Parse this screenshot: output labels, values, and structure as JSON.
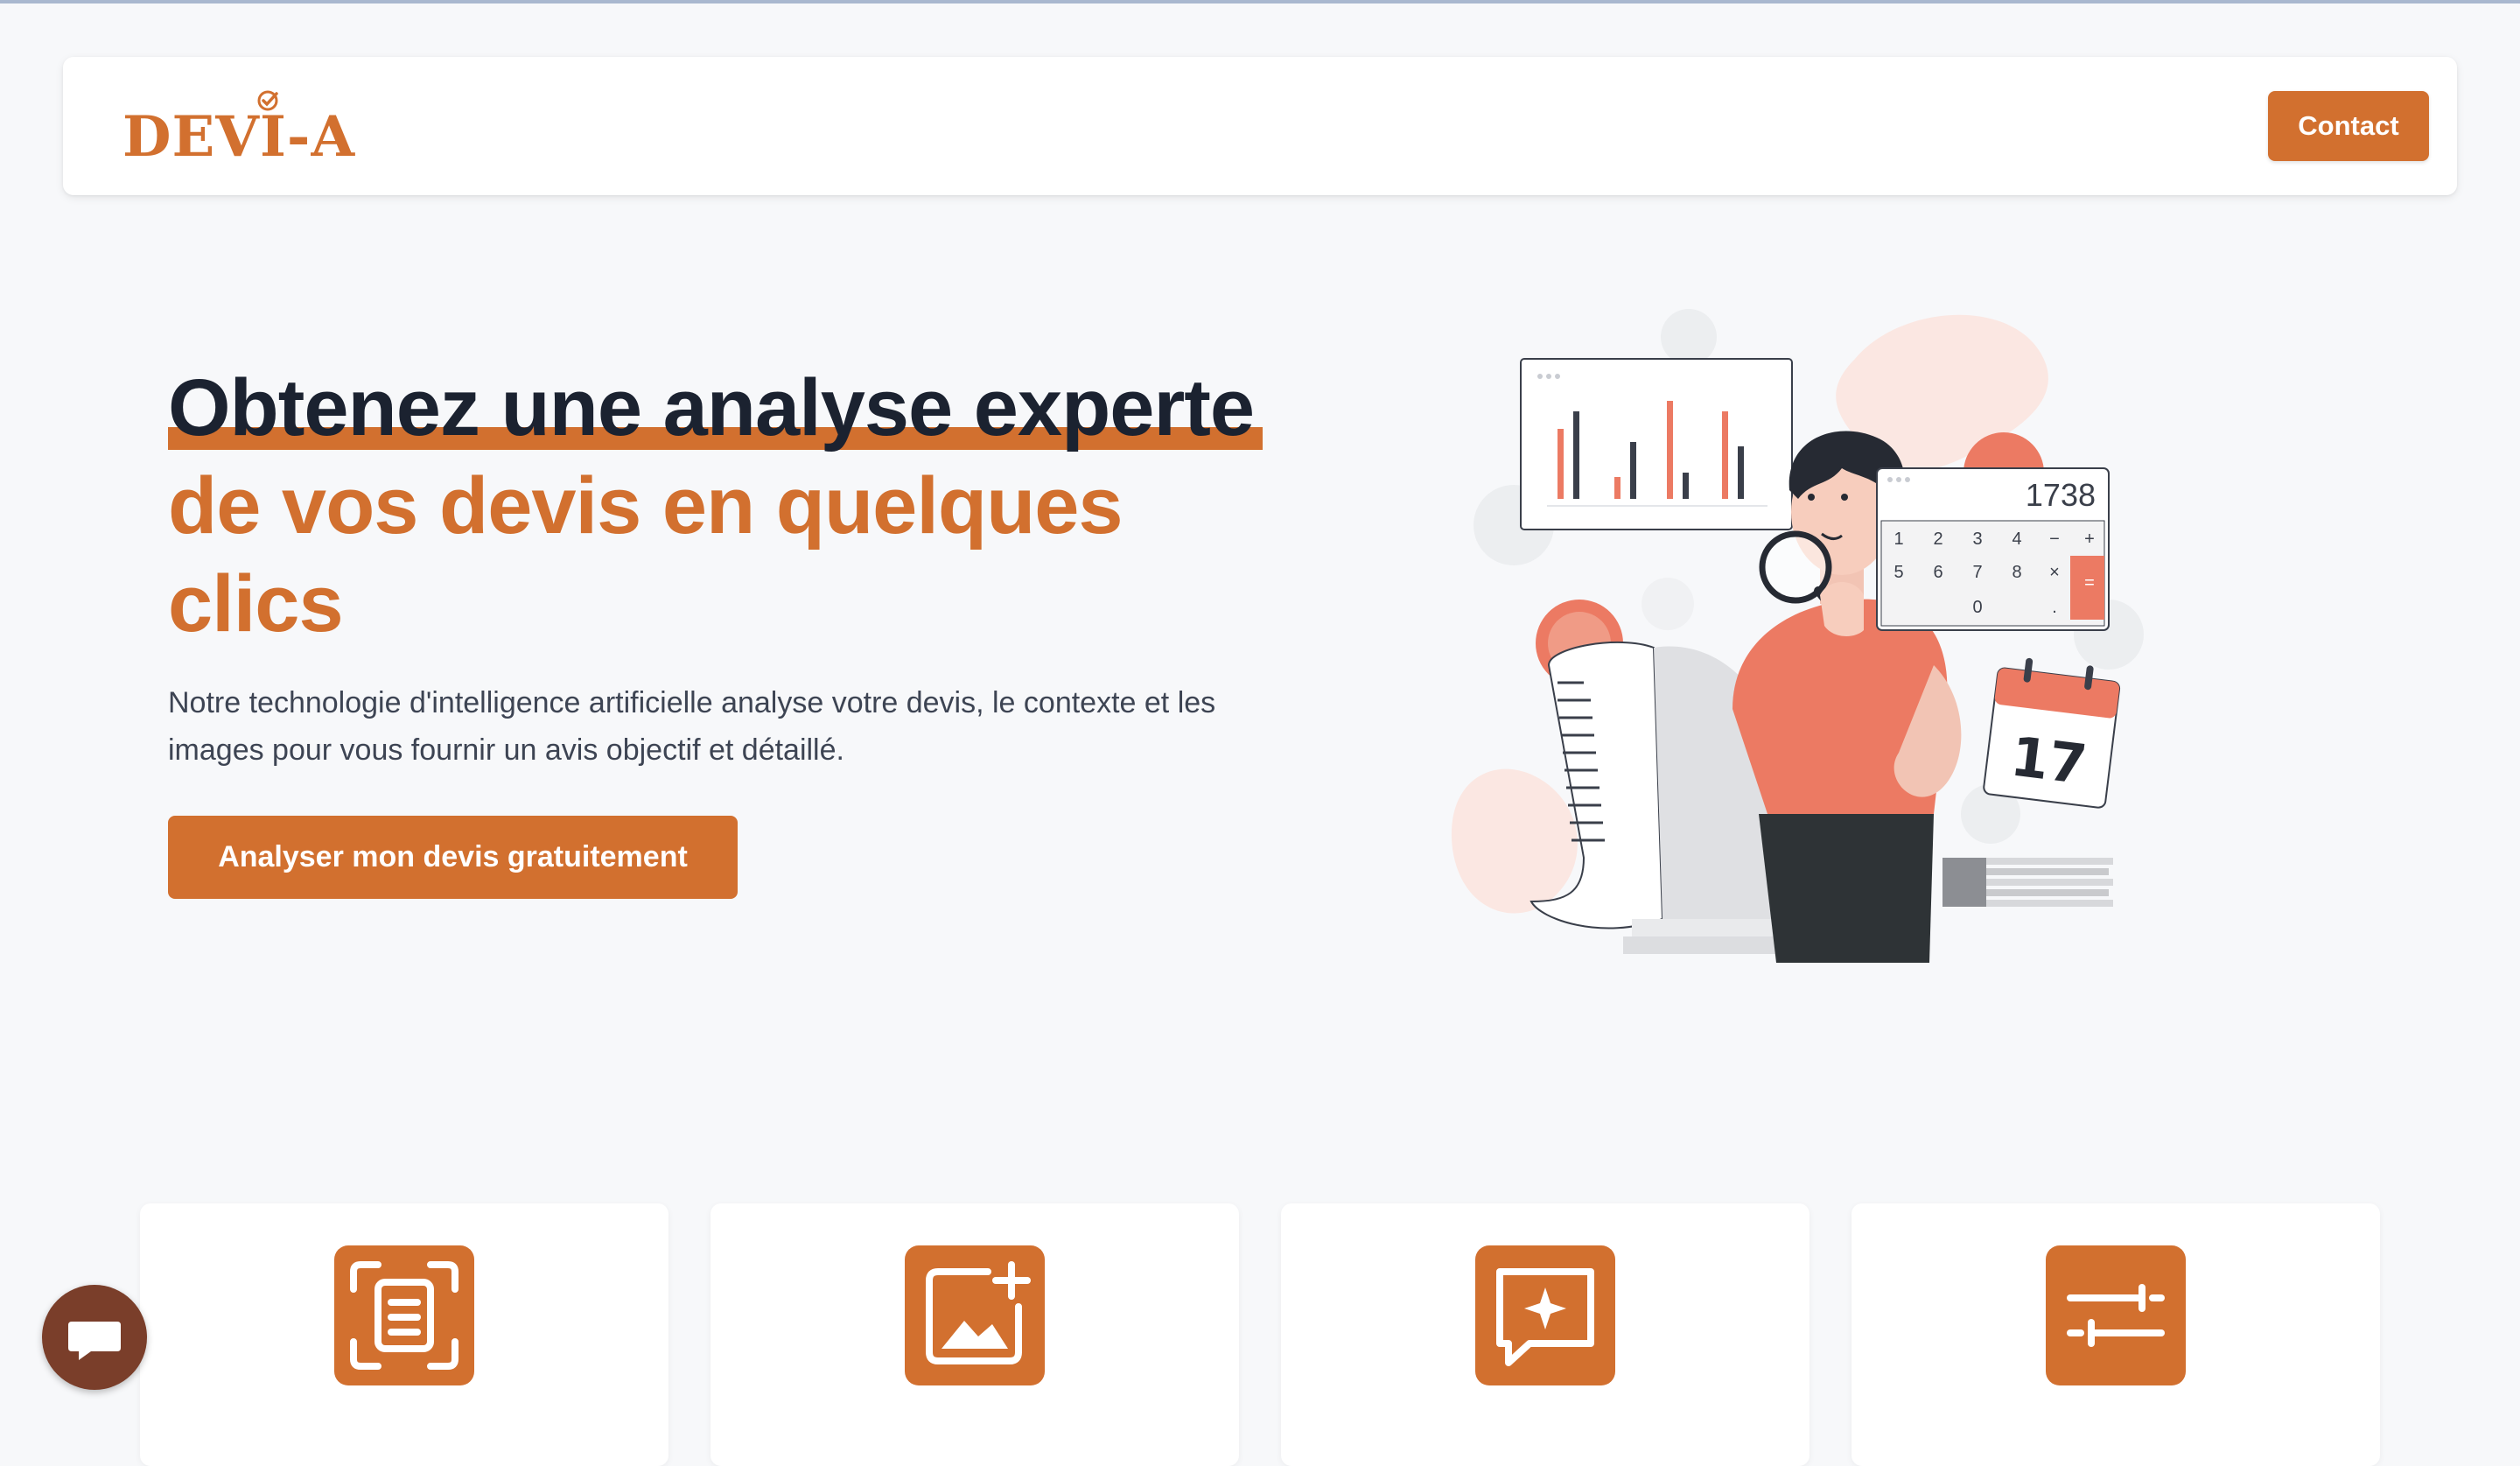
{
  "brand": {
    "name": "DEVI-A",
    "accent_color": "#d2702f",
    "dark_color": "#1b2230"
  },
  "header": {
    "contact_label": "Contact"
  },
  "hero": {
    "title_line1": "Obtenez une analyse experte",
    "title_line2": "de vos devis en quelques clics",
    "description": "Notre technologie d'intelligence artificielle analyse votre devis, le contexte et les images pour vous fournir un avis objectif et détaillé.",
    "cta_label": "Analyser mon devis gratuitement",
    "illustration": {
      "calculator_display": "1738",
      "calculator_keys": [
        "1",
        "2",
        "3",
        "4",
        "−",
        "+",
        "5",
        "6",
        "7",
        "8",
        "×",
        "=",
        "0",
        "."
      ],
      "calendar_day": "17"
    }
  },
  "features": [
    {
      "icon": "document-scan-icon",
      "label": ""
    },
    {
      "icon": "image-add-icon",
      "label": ""
    },
    {
      "icon": "chat-sparkle-icon",
      "label": ""
    },
    {
      "icon": "sliders-icon",
      "label": ""
    }
  ],
  "chat": {
    "icon": "chat-bubble-icon"
  }
}
